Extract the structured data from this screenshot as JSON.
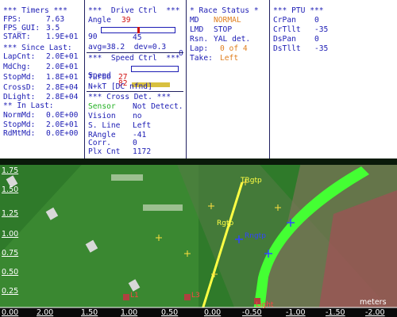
{
  "timers": {
    "title": "*** Timers ***",
    "rows": [
      {
        "label": "FPS:",
        "value": "7.63"
      },
      {
        "label": "FPS_GUI:",
        "value": "3.5"
      },
      {
        "label": "START:",
        "value": "1.9E+01"
      }
    ],
    "since_title": "*** Since Last:",
    "since_rows": [
      {
        "label": "LapCnt:",
        "value": "2.0E+01"
      },
      {
        "label": "MdChg:",
        "value": "2.0E+01"
      },
      {
        "label": "StopMd:",
        "value": "1.8E+01"
      },
      {
        "label": "CrossD:",
        "value": "2.8E+04"
      },
      {
        "label": "DLight:",
        "value": "2.8E+04"
      }
    ],
    "in_title": "** In Last:",
    "in_rows": [
      {
        "label": "NormMd:",
        "value": "0.0E+00"
      },
      {
        "label": "StopMd:",
        "value": "2.0E+01"
      },
      {
        "label": "RdMtMd:",
        "value": "0.0E+00"
      }
    ]
  },
  "drive": {
    "title": "***  Drive Ctrl  ***",
    "angle_label": "Angle",
    "angle_value": "39",
    "slider_min": "90",
    "slider_max": "0",
    "slider_level": 0.5,
    "slider_center": "45",
    "stats": "avg=38.2  dev=0.3",
    "speed_title": "***  Speed Ctrl  ***",
    "speed_label": "Speed",
    "speed_value": "82",
    "speed_fill": 0.82,
    "turbo_label": "Turbo",
    "turbo_value": "27",
    "nkt": "N+kT [DC nfnd]",
    "cross_title": "*** Cross Det. ***",
    "cross_rows": [
      {
        "label": "Sensor",
        "value": "Not Detect.",
        "label_color": "#20b020"
      },
      {
        "label": "Vision",
        "value": "no"
      },
      {
        "label": "S. Line",
        "value": "Left"
      },
      {
        "label": "RAngle",
        "value": "-41"
      },
      {
        "label": "Corr.",
        "value": "0"
      },
      {
        "label": "Plx Cnt",
        "value": "1172"
      }
    ]
  },
  "race": {
    "title": "* Race Status *",
    "md_label": "MD",
    "md_value": "NORMAL",
    "lmd_label": "LMD",
    "lmd_value": "STOP",
    "rsn_label": "Rsn.",
    "rsn_value": "YAL det.",
    "lap_label": "Lap:",
    "lap_value": "0 of 4",
    "take_label": "Take:",
    "take_value": "Left"
  },
  "ptu": {
    "title": "*** PTU ***",
    "rows": [
      {
        "label": "CrPan",
        "value": "0"
      },
      {
        "label": "CrTllt",
        "value": "-35"
      },
      {
        "label": "DsPan",
        "value": "0"
      },
      {
        "label": "DsTllt",
        "value": "-35"
      }
    ]
  },
  "view": {
    "x_unit": "meters",
    "x_ticks": [
      "2.00",
      "1.50",
      "1.00",
      "0.50",
      "0.00",
      "-0.50",
      "-1.00",
      "-1.50",
      "-2.00"
    ],
    "y_ticks": [
      "1.75",
      "1.50",
      "1.25",
      "1.00",
      "0.75",
      "0.50",
      "0.25",
      "0.00"
    ],
    "markers": {
      "trgtp": "TRgtp",
      "rgtp": "Rgtp",
      "rngtp": "Rngtp",
      "l1": "L1",
      "l3": "L3",
      "light": "Light"
    },
    "colors": {
      "grass": "#2f7a2a",
      "track": "#9ad36a",
      "lane": "#44ff33",
      "laser": "#ffff44"
    }
  }
}
